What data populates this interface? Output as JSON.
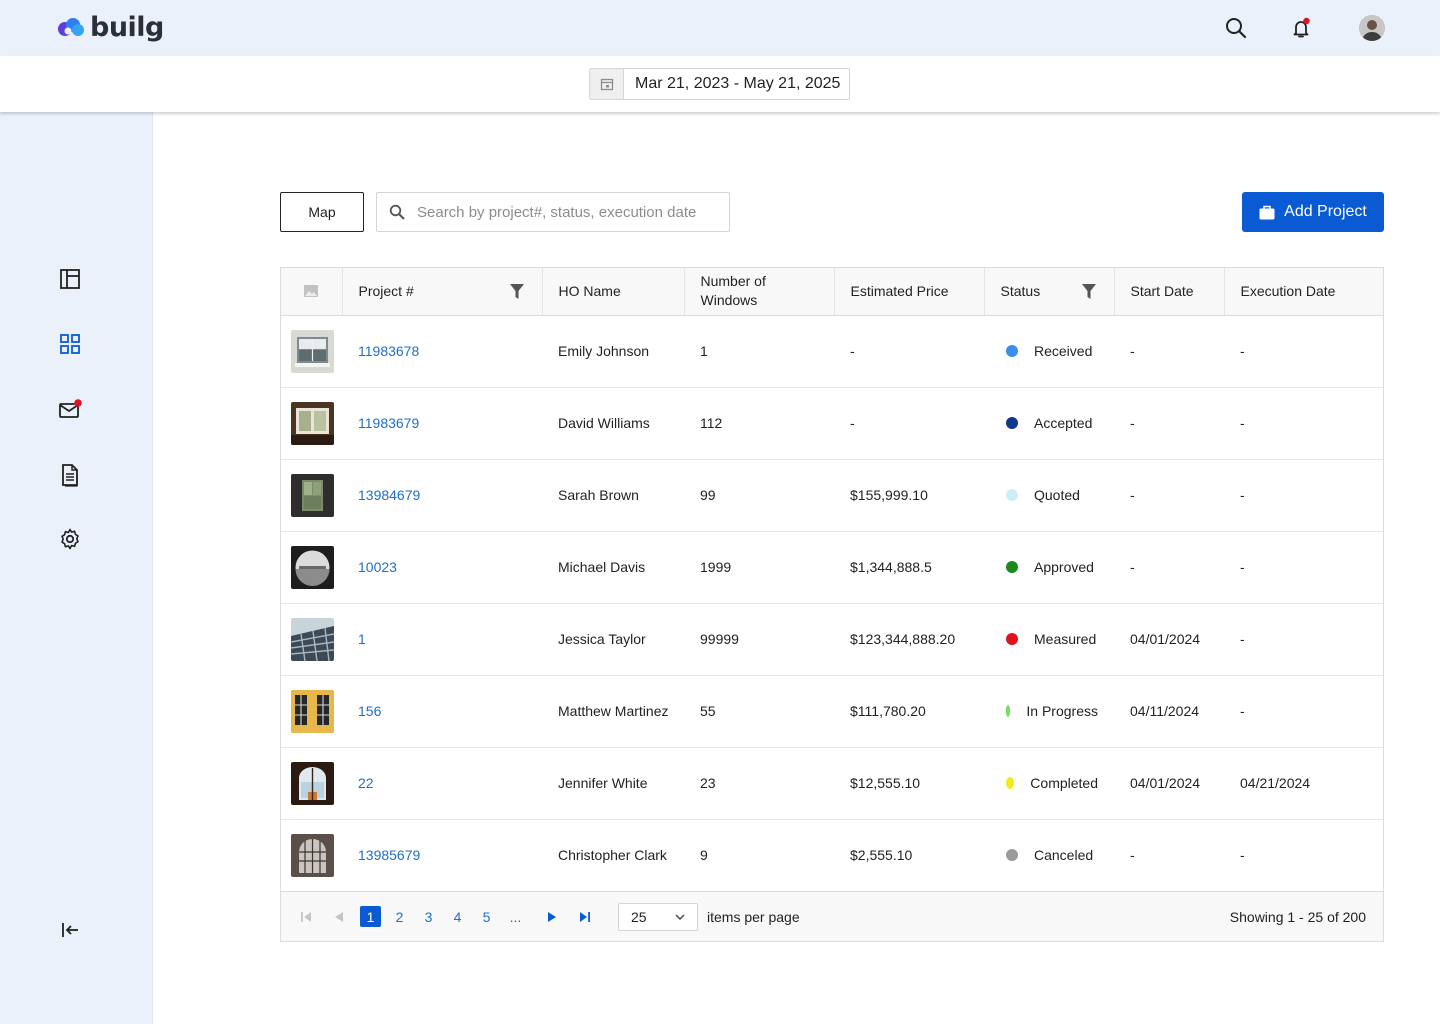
{
  "brand": {
    "name": "builg"
  },
  "date_range": "Mar 21, 2023 - May 21, 2025",
  "toolbar": {
    "map_label": "Map",
    "search_placeholder": "Search by project#, status, execution date",
    "add_label": "Add Project"
  },
  "table": {
    "columns": [
      "",
      "Project #",
      "HO Name",
      "Number of Windows",
      "Estimated Price",
      "Status",
      "Start Date",
      "Execution Date"
    ],
    "rows": [
      {
        "project": "11983678",
        "ho_name": "Emily Johnson",
        "windows": "1",
        "price": "-",
        "status": "Received",
        "status_color": "#3a8dea",
        "start": "-",
        "execution": "-"
      },
      {
        "project": "11983679",
        "ho_name": "David Williams",
        "windows": "112",
        "price": "-",
        "status": "Accepted",
        "status_color": "#0d3a8a",
        "start": "-",
        "execution": "-"
      },
      {
        "project": "13984679",
        "ho_name": "Sarah Brown",
        "windows": "99",
        "price": "$155,999.10",
        "status": "Quoted",
        "status_color": "#cdeef8",
        "start": "-",
        "execution": "-"
      },
      {
        "project": "10023",
        "ho_name": "Michael Davis",
        "windows": "1999",
        "price": "$1,344,888.5",
        "status": "Approved",
        "status_color": "#1c8a1c",
        "start": "-",
        "execution": "-"
      },
      {
        "project": "1",
        "ho_name": "Jessica Taylor",
        "windows": "99999",
        "price": "$123,344,888.20",
        "status": "Measured",
        "status_color": "#e0141e",
        "start": "04/01/2024",
        "execution": "-"
      },
      {
        "project": "156",
        "ho_name": "Matthew Martinez",
        "windows": "55",
        "price": "$111,780.20",
        "status": "In Progress",
        "status_color": "#6ee35a",
        "start": "04/11/2024",
        "execution": "-"
      },
      {
        "project": "22",
        "ho_name": "Jennifer White",
        "windows": "23",
        "price": "$12,555.10",
        "status": "Completed",
        "status_color": "#f2ea1c",
        "start": "04/01/2024",
        "execution": "04/21/2024"
      },
      {
        "project": "13985679",
        "ho_name": "Christopher Clark",
        "windows": "9",
        "price": "$2,555.10",
        "status": "Canceled",
        "status_color": "#9a9a9a",
        "start": "-",
        "execution": "-"
      }
    ]
  },
  "pagination": {
    "pages": [
      "1",
      "2",
      "3",
      "4",
      "5",
      "..."
    ],
    "current": "1",
    "per_page": "25",
    "per_page_label": "items per page",
    "showing": "Showing 1 - 25 of 200"
  }
}
